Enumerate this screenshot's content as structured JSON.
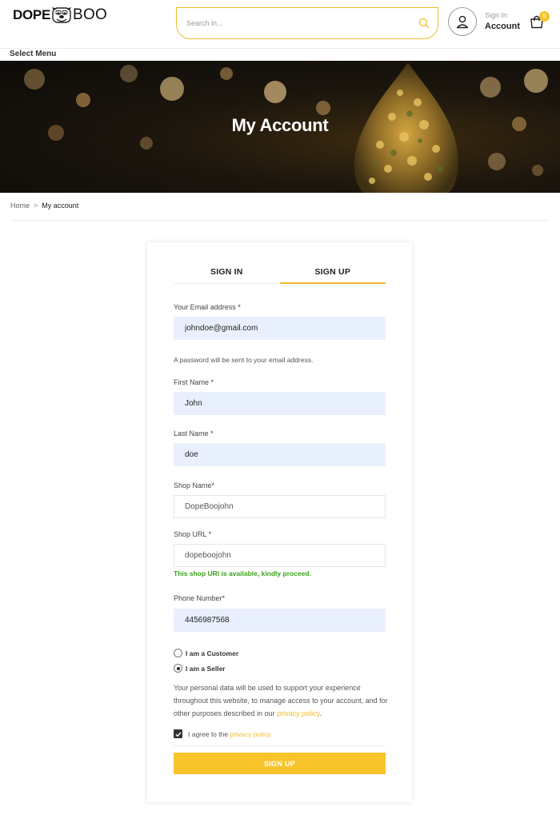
{
  "header": {
    "logo_word_1": "DOPE",
    "logo_word_2": "BOO",
    "search_placeholder": "Search in...",
    "account_top": "Sign In",
    "account_main": "Account",
    "cart_count": "0"
  },
  "menu": {
    "label": "Select Menu"
  },
  "banner": {
    "title": "My Account"
  },
  "breadcrumb": {
    "home": "Home",
    "separator": ">",
    "current": "My account"
  },
  "tabs": {
    "signin": "SIGN IN",
    "signup": "SIGN UP",
    "active": "signup"
  },
  "form": {
    "email_label": "Your Email address *",
    "email_value": "johndoe@gmail.com",
    "password_hint": "A password will be sent to your email address.",
    "first_name_label": "First Name *",
    "first_name_value": "John",
    "last_name_label": "Last Name *",
    "last_name_value": "doe",
    "shop_name_label": "Shop Name*",
    "shop_name_value": "DopeBoojohn",
    "shop_url_label": "Shop URL *",
    "shop_url_value": "dopeboojohn",
    "shop_url_status": "This shop URl is available, kindly proceed.",
    "phone_label": "Phone Number*",
    "phone_value": "4456987568",
    "role_customer": "I am a Customer",
    "role_seller": "I am a Seller",
    "role_selected": "seller",
    "privacy_text_before": "Your personal data will be used to support your experience throughout this website, to manage access to your account, and for other purposes described in our ",
    "privacy_link": "privacy policy",
    "privacy_text_after": ".",
    "agree_text": "I agree to the ",
    "agree_link": "privacy policy",
    "agree_checked": true,
    "submit_label": "SIGN UP"
  },
  "colors": {
    "accent": "#f7c42b",
    "success": "#3aa21b",
    "input_fill": "#e9f0fd"
  }
}
